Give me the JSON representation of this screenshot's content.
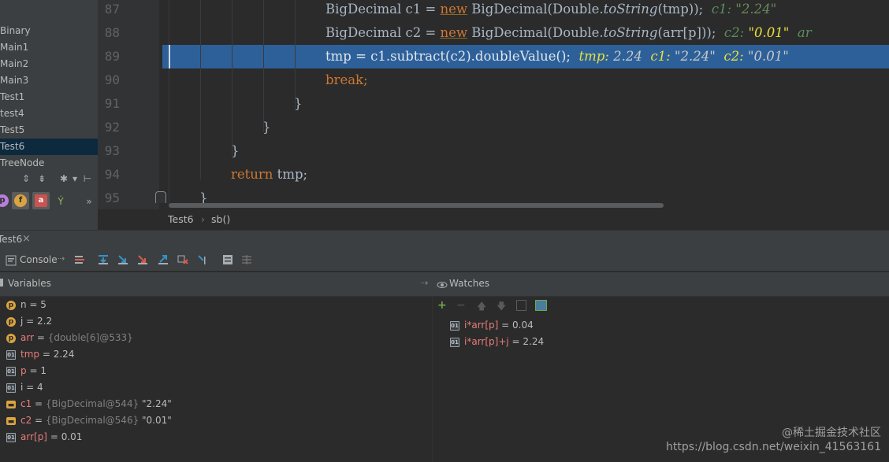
{
  "project": {
    "items": [
      "Binary",
      "Main1",
      "Main2",
      "Main3",
      "Test1",
      "test4",
      "Test5",
      "Test6",
      "TreeNode"
    ],
    "selected_index": 7,
    "overflow_label": "»"
  },
  "editor": {
    "line_numbers": [
      "87",
      "88",
      "89",
      "90",
      "91",
      "92",
      "93",
      "94",
      "95"
    ],
    "line87": {
      "code_a": "BigDecimal c1 = ",
      "kw_new": "new",
      "code_b": " BigDecimal(Double.",
      "method": "toString",
      "code_c": "(tmp));",
      "hint_key": "c1: ",
      "hint_val": "\"2.24\""
    },
    "line88": {
      "code_a": "BigDecimal c2 = ",
      "kw_new": "new",
      "code_b": " BigDecimal(Double.",
      "method": "toString",
      "code_c": "(arr[p]));",
      "hint_key": "c2: ",
      "hint_val": "\"0.01\"",
      "hint_trail": "ar"
    },
    "line89": {
      "code": "tmp = c1.subtract(c2).doubleValue();",
      "hint1_key": "tmp: ",
      "hint1_val": "2.24",
      "hint2_key": "c1: ",
      "hint2_val": "\"2.24\"",
      "hint3_key": "c2: ",
      "hint3_val": "\"0.01\""
    },
    "line90": {
      "kw": "break",
      "tail": ";"
    },
    "line91": "}",
    "line92": "}",
    "line93": "}",
    "line94": {
      "kw": "return",
      "tail": " tmp;"
    },
    "line95": "}",
    "breadcrumb": {
      "class_name": "Test6",
      "separator": "›",
      "method_name": "sb()"
    }
  },
  "debug": {
    "tab_label": "Test6",
    "tab_close": "×",
    "console_label": "Console",
    "variables_label": "Variables",
    "watches_label": "Watches",
    "variables": [
      {
        "icon": "p",
        "name": "n",
        "eq": " = ",
        "value": "5",
        "ref": ""
      },
      {
        "icon": "p",
        "name": "j",
        "eq": " = ",
        "value": "2.2",
        "ref": ""
      },
      {
        "icon": "p",
        "name": "arr",
        "eq": " = ",
        "value": "",
        "ref": "{double[6]@533}"
      },
      {
        "icon": "local",
        "name": "tmp",
        "eq": " = ",
        "value": "2.24",
        "ref": ""
      },
      {
        "icon": "local",
        "name": "p",
        "eq": " = ",
        "value": "1",
        "ref": ""
      },
      {
        "icon": "local",
        "name": "i",
        "eq": " = ",
        "value": "4",
        "ref": ""
      },
      {
        "icon": "obj",
        "name": "c1",
        "eq": " = ",
        "value": "\"2.24\"",
        "ref": "{BigDecimal@544} "
      },
      {
        "icon": "obj",
        "name": "c2",
        "eq": " = ",
        "value": "\"0.01\"",
        "ref": "{BigDecimal@546} "
      },
      {
        "icon": "local",
        "name": "arr[p]",
        "eq": " = ",
        "value": "0.01",
        "ref": ""
      }
    ],
    "watches": [
      {
        "name": "i*arr[p]",
        "eq": " = ",
        "value": "0.04"
      },
      {
        "name": "i*arr[p]+j",
        "eq": " = ",
        "value": "2.24"
      }
    ]
  },
  "watermark": {
    "line1": "@稀土掘金技术社区",
    "line2": "https://blog.csdn.net/weixin_41563161"
  },
  "colors": {
    "highlight": "#2d6099",
    "keyword": "#cc7832",
    "debug_hint_key": "#e8e03c",
    "variable_name": "#e97b7b"
  }
}
